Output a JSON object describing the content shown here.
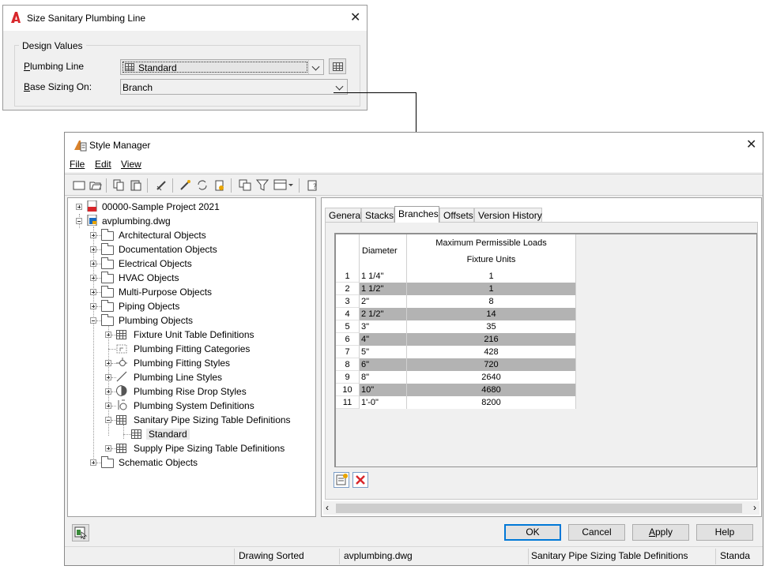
{
  "size_dialog": {
    "title": "Size Sanitary Plumbing Line",
    "group_label": "Design Values",
    "plumbing_line_label": "Plumbing Line",
    "plumbing_line_value": "Standard",
    "base_sizing_label": "Base Sizing On:",
    "base_sizing_value": "Branch"
  },
  "style_manager": {
    "title": "Style Manager",
    "menu": [
      "File",
      "Edit",
      "View"
    ],
    "tree": [
      {
        "label": "00000-Sample Project 2021"
      },
      {
        "label": "avplumbing.dwg"
      },
      {
        "label": "Architectural Objects"
      },
      {
        "label": "Documentation Objects"
      },
      {
        "label": "Electrical Objects"
      },
      {
        "label": "HVAC Objects"
      },
      {
        "label": "Multi-Purpose Objects"
      },
      {
        "label": "Piping Objects"
      },
      {
        "label": "Plumbing Objects"
      },
      {
        "label": "Fixture Unit Table Definitions"
      },
      {
        "label": "Plumbing Fitting Categories"
      },
      {
        "label": "Plumbing Fitting Styles"
      },
      {
        "label": "Plumbing Line Styles"
      },
      {
        "label": "Plumbing Rise Drop Styles"
      },
      {
        "label": "Plumbing System Definitions"
      },
      {
        "label": "Sanitary Pipe Sizing Table Definitions"
      },
      {
        "label": "Standard"
      },
      {
        "label": "Supply Pipe Sizing Table Definitions"
      },
      {
        "label": "Schematic Objects"
      }
    ],
    "tabs": [
      "General",
      "Stacks",
      "Branches",
      "Offsets",
      "Version History"
    ],
    "active_tab": "Branches",
    "table": {
      "col_diameter": "Diameter",
      "col_loads_line1": "Maximum Permissible Loads",
      "col_loads_line2": "Fixture Units",
      "rows": [
        {
          "n": "1",
          "diameter": "1 1/4\"",
          "load": "1"
        },
        {
          "n": "2",
          "diameter": "1 1/2\"",
          "load": "1"
        },
        {
          "n": "3",
          "diameter": "2\"",
          "load": "8"
        },
        {
          "n": "4",
          "diameter": "2 1/2\"",
          "load": "14"
        },
        {
          "n": "5",
          "diameter": "3\"",
          "load": "35"
        },
        {
          "n": "6",
          "diameter": "4\"",
          "load": "216"
        },
        {
          "n": "7",
          "diameter": "5\"",
          "load": "428"
        },
        {
          "n": "8",
          "diameter": "6\"",
          "load": "720"
        },
        {
          "n": "9",
          "diameter": "8\"",
          "load": "2640"
        },
        {
          "n": "10",
          "diameter": "10\"",
          "load": "4680"
        },
        {
          "n": "11",
          "diameter": "1'-0\"",
          "load": "8200"
        }
      ]
    },
    "buttons": {
      "ok": "OK",
      "cancel": "Cancel",
      "apply": "Apply",
      "help": "Help"
    },
    "status": {
      "sort": "Drawing Sorted",
      "drawing": "avplumbing.dwg",
      "category": "Sanitary Pipe Sizing Table Definitions",
      "style": "Standa"
    }
  },
  "colors": {
    "accent": "#0078d7",
    "autodesk_red": "#d8262b",
    "stripe": "#b3b3b3"
  }
}
